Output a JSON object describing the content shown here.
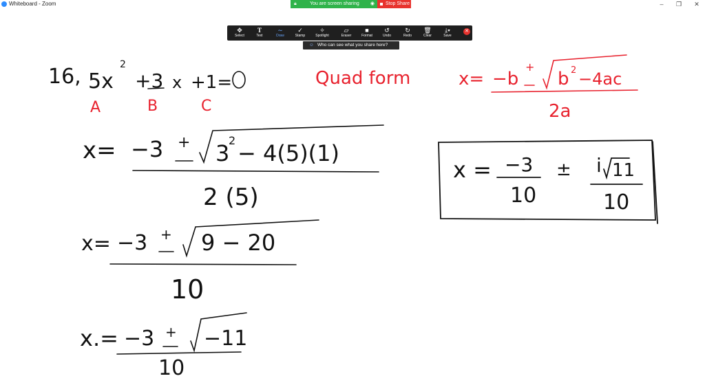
{
  "window": {
    "title": "Whiteboard - Zoom",
    "controls": [
      "–",
      "❐",
      "✕"
    ]
  },
  "share_banner": {
    "status": "You are screen sharing",
    "stop_label": "Stop Share"
  },
  "toolbar": {
    "tools": [
      {
        "label": "Select",
        "icon": "move-icon"
      },
      {
        "label": "Text",
        "icon": "text-icon"
      },
      {
        "label": "Draw",
        "icon": "draw-icon"
      },
      {
        "label": "Stamp",
        "icon": "stamp-check-icon"
      },
      {
        "label": "Spotlight",
        "icon": "spotlight-icon"
      },
      {
        "label": "Eraser",
        "icon": "eraser-icon"
      },
      {
        "label": "Format",
        "icon": "format-square-icon"
      },
      {
        "label": "Undo",
        "icon": "undo-icon"
      },
      {
        "label": "Redo",
        "icon": "redo-icon"
      },
      {
        "label": "Clear",
        "icon": "trash-icon"
      },
      {
        "label": "Save",
        "icon": "save-icon"
      }
    ],
    "active_tool": "Draw",
    "who_can_see": "Who can see what you share here?"
  },
  "whiteboard": {
    "problem_number": "16.",
    "equation": "5x² + 3x + 1 = 0",
    "coeff_labels": [
      "A",
      "B",
      "C"
    ],
    "formula_name": "Quad form",
    "quadratic_formula": "x = −b ± √(b² − 4ac) / 2a",
    "step1": "x = −3 ± √(3² − 4(5)(1)) / 2(5)",
    "step2": "x = −3 ± √(9 − 20) / 10",
    "step3": "x = −3 ± √−11 / 10",
    "answer": "x = −3/10 ± i√11/10",
    "ink_colors": {
      "black": "#111111",
      "red": "#e8222e"
    }
  }
}
